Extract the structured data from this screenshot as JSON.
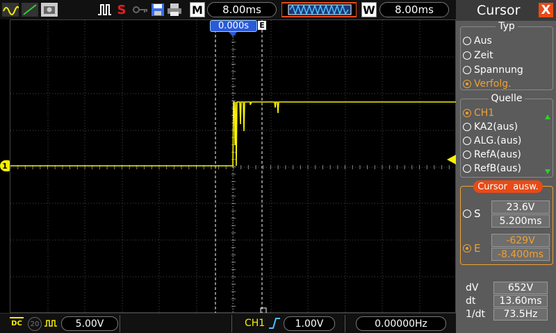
{
  "topbar": {
    "mode_letter": "M",
    "timebase": "8.00ms",
    "window_letter": "W",
    "window_timebase": "8.00ms",
    "stop_letter": "S",
    "icons": [
      "waveform-yellow-icon",
      "waveform-green-icon",
      "camera-icon",
      "trigger-edge-icon",
      "stop-icon",
      "key-icon",
      "save-icon",
      "print-icon",
      "memory-overview-icon"
    ]
  },
  "screen": {
    "trigger_position": "0.000s",
    "end_cursor_marker": "E",
    "channel1_marker": "1",
    "channel1_color": "#f8f000",
    "grid_color": "#4a4a4a",
    "cursor_color": "#ffffff"
  },
  "bottombar": {
    "coupling": "DC",
    "bw_limit": "20",
    "ch1_scale": "5.00V",
    "trigger_source": "CH1",
    "trigger_level": "1.00V",
    "frequency": "0.00000Hz"
  },
  "panel": {
    "title": "Cursor",
    "close": "X",
    "type_section": {
      "title": "Typ",
      "options": [
        {
          "label": "Aus",
          "selected": false
        },
        {
          "label": "Zeit",
          "selected": false
        },
        {
          "label": "Spannung",
          "selected": false
        },
        {
          "label": "Verfolg.",
          "selected": true
        }
      ]
    },
    "source_section": {
      "title": "Quelle",
      "options": [
        {
          "label": "CH1",
          "selected": true
        },
        {
          "label": "KA2(aus)",
          "selected": false
        },
        {
          "label": "ALG.(aus)",
          "selected": false
        },
        {
          "label": "RefA(aus)",
          "selected": false
        },
        {
          "label": "RefB(aus)",
          "selected": false
        }
      ]
    },
    "cursor_select": {
      "title": "Cursor  ausw.",
      "s_label": "S",
      "s_voltage": "23.6V",
      "s_time": "5.200ms",
      "e_label": "E",
      "e_voltage": "-629V",
      "e_time": "-8.400ms"
    },
    "measurements": {
      "dv_label": "dV",
      "dv_value": "652V",
      "dt_label": "dt",
      "dt_value": "13.60ms",
      "inv_dt_label": "1/dt",
      "inv_dt_value": "73.5Hz"
    }
  }
}
